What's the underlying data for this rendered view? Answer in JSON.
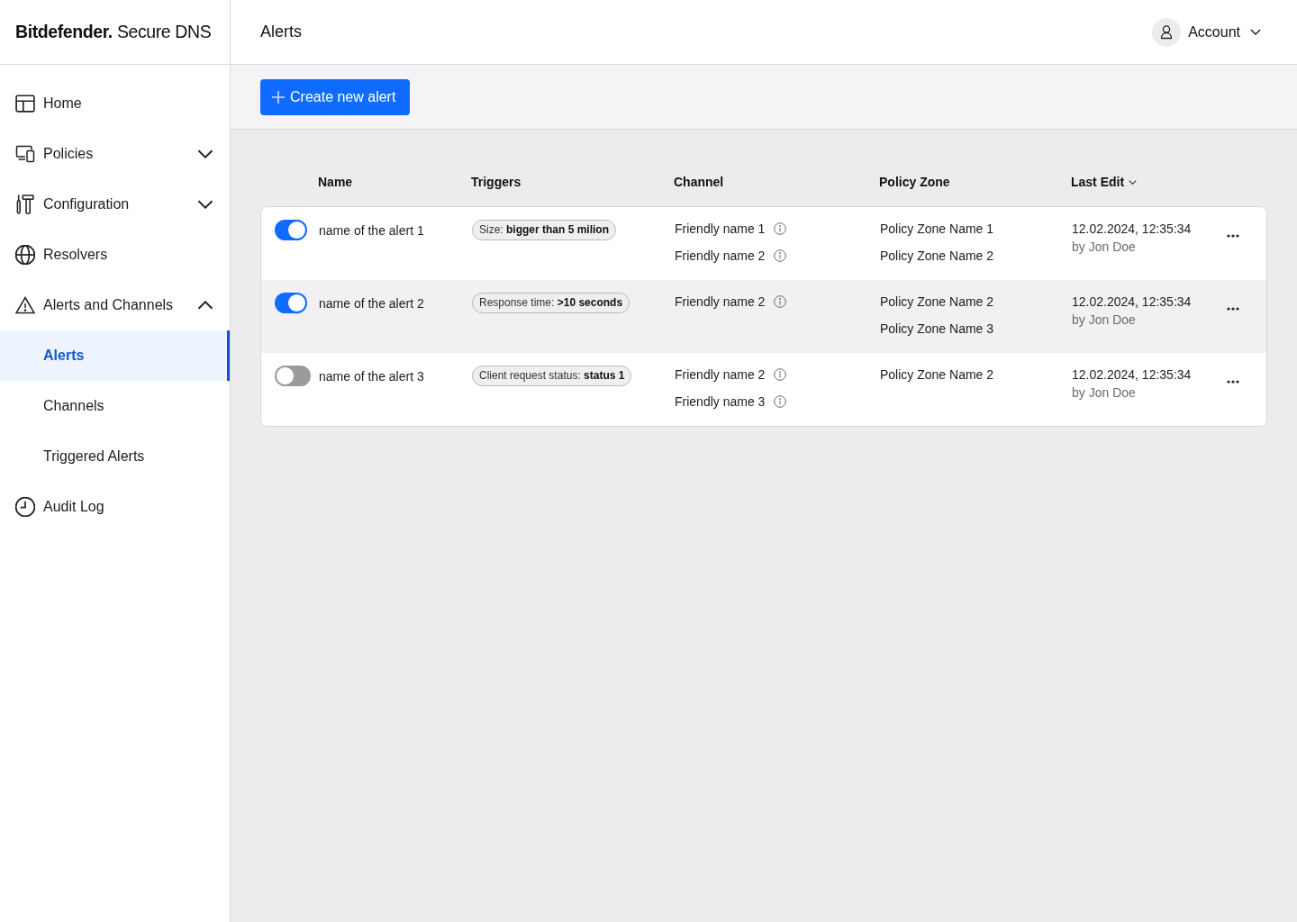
{
  "sidebar": {
    "logo": "**Bitdefender.** Secure DNS",
    "items": [
      {
        "label": "Home",
        "selected": false
      },
      {
        "label": "Policies",
        "selected": false,
        "expanded": false
      },
      {
        "label": "Configuration",
        "selected": false,
        "expanded": false
      },
      {
        "label": "Resolvers",
        "selected": false
      },
      {
        "label": "Alerts and Channels",
        "selected": false,
        "expanded": true,
        "children": [
          {
            "label": "Alerts",
            "selected": true
          },
          {
            "label": "Channels",
            "selected": false
          },
          {
            "label": "Triggered Alerts",
            "selected": false
          }
        ]
      },
      {
        "label": "Audit Log",
        "selected": false
      }
    ]
  },
  "header": {
    "title": "Alerts",
    "account": "Account"
  },
  "toolbar": {
    "create_button": "Create new alert"
  },
  "table": {
    "columns": [
      {
        "label": "Name",
        "sorted": false
      },
      {
        "label": "Triggers",
        "sorted": false
      },
      {
        "label": "Channel",
        "sorted": false
      },
      {
        "label": "Policy Zone",
        "sorted": false
      },
      {
        "label": "Last Edit",
        "sorted": true
      }
    ],
    "rows": [
      {
        "enabled": true,
        "hovered": false,
        "name": "name of the alert 1",
        "trigger": "Size: **bigger than 5 milion**",
        "channels": [
          "Friendly name 1",
          "Friendly name 2"
        ],
        "policy_zones": [
          "Policy Zone Name 1",
          "Policy Zone Name 2"
        ],
        "last_edit": "12.02.2024, 12:35:34",
        "edited_by": "by Jon Doe"
      },
      {
        "enabled": true,
        "hovered": true,
        "name": "name of the alert 2",
        "trigger": "Response time: **>10 seconds**",
        "channels": [
          "Friendly name 2"
        ],
        "policy_zones": [
          "Policy Zone Name 2",
          "Policy Zone Name 3"
        ],
        "last_edit": "12.02.2024, 12:35:34",
        "edited_by": "by Jon Doe"
      },
      {
        "enabled": false,
        "hovered": false,
        "name": "name of the alert 3",
        "trigger": "Client request status: **status 1**",
        "channels": [
          "Friendly name 2",
          "Friendly name 3"
        ],
        "policy_zones": [
          "Policy Zone Name 2"
        ],
        "last_edit": "12.02.2024, 12:35:34",
        "edited_by": "by Jon Doe"
      }
    ]
  }
}
